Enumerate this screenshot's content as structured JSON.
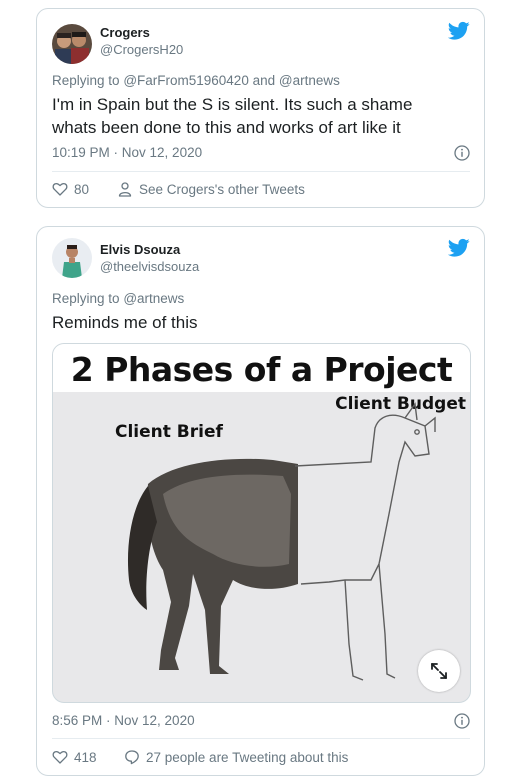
{
  "colors": {
    "twitter_blue": "#1da1f2",
    "muted": "#697882",
    "text": "#1c2022",
    "border": "#cfd9de"
  },
  "tweets": [
    {
      "author": {
        "name": "Crogers",
        "handle": "@CrogersH20"
      },
      "reply_prefix": "Replying to",
      "reply_to_1": "@FarFrom51960420",
      "reply_join": "and",
      "reply_to_2": "@artnews",
      "text_line1": "I'm in Spain but the S is silent. Its such a shame",
      "text_line2": "whats been done to this and works of art like it",
      "timestamp": "10:19 PM · Nov 12, 2020",
      "likes": "80",
      "secondary_action": "See Crogers's other Tweets"
    },
    {
      "author": {
        "name": "Elvis Dsouza",
        "handle": "@theelvisdsouza"
      },
      "reply_prefix": "Replying to",
      "reply_to_1": "@artnews",
      "text_line1": "Reminds me of this",
      "media": {
        "title": "2 Phases of a Project",
        "label_left": "Client Brief",
        "label_right": "Client Budget"
      },
      "timestamp": "8:56 PM · Nov 12, 2020",
      "likes": "418",
      "secondary_action": "27 people are Tweeting about this"
    }
  ]
}
